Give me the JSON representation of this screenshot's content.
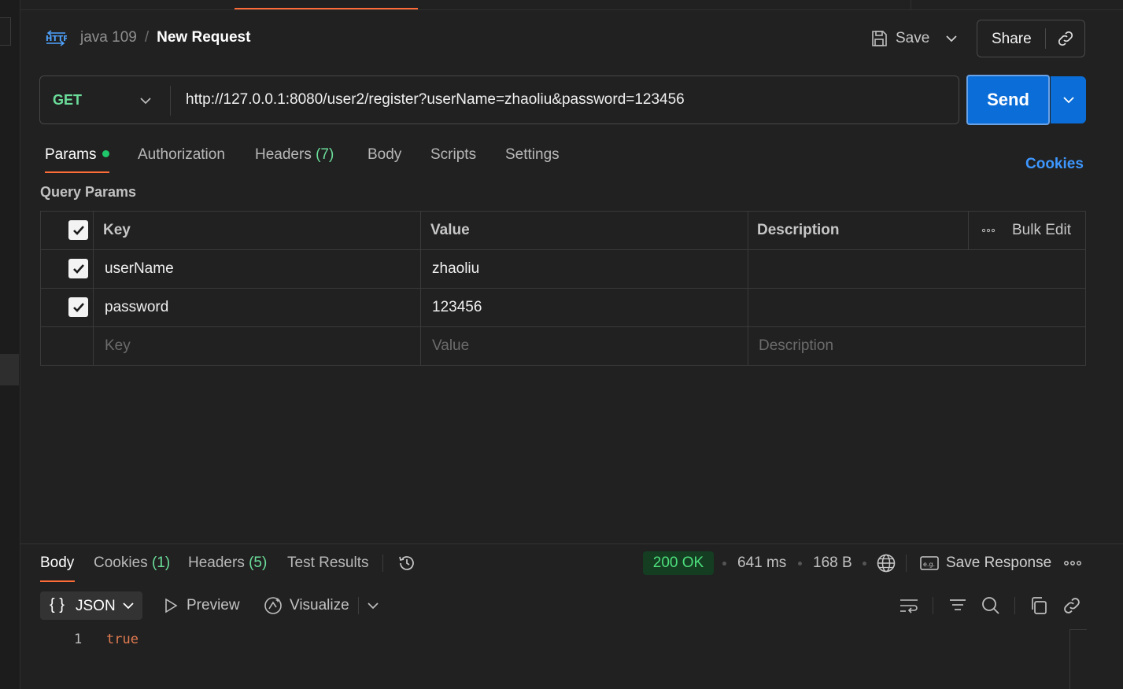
{
  "breadcrumb": {
    "icon": "http-icon",
    "parent": "java 109",
    "separator": "/",
    "current": "New Request"
  },
  "header_actions": {
    "save_label": "Save",
    "share_label": "Share"
  },
  "request": {
    "method": "GET",
    "url": "http://127.0.0.1:8080/user2/register?userName=zhaoliu&password=123456",
    "send_label": "Send"
  },
  "request_tabs": [
    {
      "label": "Params",
      "active": true,
      "dot": true
    },
    {
      "label": "Authorization"
    },
    {
      "label": "Headers",
      "count": "(7)"
    },
    {
      "label": "Body"
    },
    {
      "label": "Scripts"
    },
    {
      "label": "Settings"
    }
  ],
  "cookies_link": "Cookies",
  "query_params": {
    "title": "Query Params",
    "headers": {
      "key": "Key",
      "value": "Value",
      "description": "Description",
      "bulk_edit": "Bulk Edit"
    },
    "rows": [
      {
        "checked": true,
        "key": "userName",
        "value": "zhaoliu",
        "description": ""
      },
      {
        "checked": true,
        "key": "password",
        "value": "123456",
        "description": ""
      }
    ],
    "placeholders": {
      "key": "Key",
      "value": "Value",
      "description": "Description"
    }
  },
  "response": {
    "tabs": [
      {
        "label": "Body",
        "active": true
      },
      {
        "label": "Cookies",
        "count": "(1)"
      },
      {
        "label": "Headers",
        "count": "(5)"
      },
      {
        "label": "Test Results"
      }
    ],
    "status": "200 OK",
    "time": "641 ms",
    "size": "168 B",
    "save_response_label": "Save Response",
    "format": "JSON",
    "preview_label": "Preview",
    "visualize_label": "Visualize",
    "body_lines": [
      {
        "line": "1",
        "text": "true"
      }
    ]
  },
  "colors": {
    "accent": "#ff6c37",
    "send_blue": "#0b6ed8",
    "status_green": "#4ee07d",
    "method_green": "#6bdd9a",
    "link_blue": "#3d97ff"
  }
}
